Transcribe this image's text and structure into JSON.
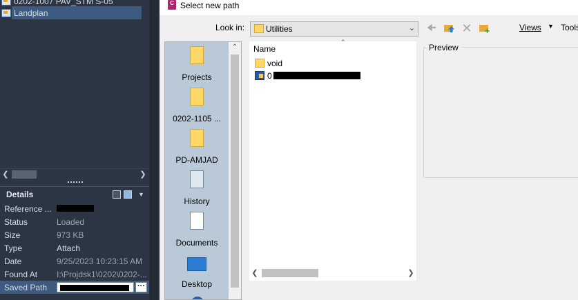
{
  "left_panel": {
    "tree": [
      {
        "label": "0202-1007 PAV_STM S-05"
      },
      {
        "label": "Landplan",
        "selected": true
      }
    ],
    "details": {
      "title": "Details",
      "properties": [
        {
          "key": "Reference ...",
          "value": ""
        },
        {
          "key": "Status",
          "value": "Loaded"
        },
        {
          "key": "Size",
          "value": "973 KB"
        },
        {
          "key": "Type",
          "value": "Attach"
        },
        {
          "key": "Date",
          "value": "9/25/2023 10:23:15 AM"
        },
        {
          "key": "Found At",
          "value": "I:\\Projdsk1\\0202\\0202-..."
        },
        {
          "key": "Saved Path",
          "value": ""
        }
      ],
      "ellipsis": "···"
    }
  },
  "dialog": {
    "title": "Select new path",
    "app_icon_text": "C",
    "look_in_label": "Look in:",
    "look_in_value": "Utilities",
    "views_label": "Views",
    "tools_label": "Tools",
    "places": [
      {
        "label": "Projects",
        "icon": "folder-icon"
      },
      {
        "label": "0202-1105 ...",
        "icon": "folder-icon"
      },
      {
        "label": "PD-AMJAD",
        "icon": "folder-icon"
      },
      {
        "label": "History",
        "icon": "history-icon"
      },
      {
        "label": "Documents",
        "icon": "documents-icon"
      },
      {
        "label": "Desktop",
        "icon": "desktop-icon"
      }
    ],
    "file_list": {
      "column_name": "Name",
      "items": [
        {
          "name": "void",
          "icon": "folder-icon"
        },
        {
          "name": "0",
          "icon": "dwg-file-icon"
        }
      ]
    },
    "preview_label": "Preview"
  }
}
